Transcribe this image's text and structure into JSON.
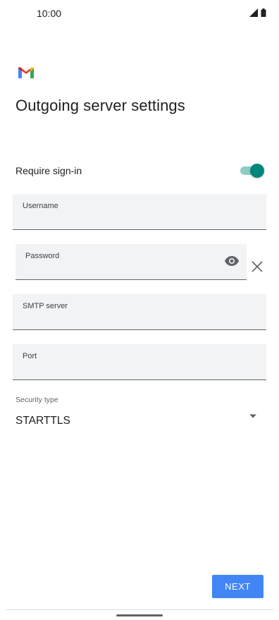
{
  "status_bar": {
    "time": "10:00",
    "icons": [
      "signal-icon",
      "battery-icon"
    ]
  },
  "app": {
    "logo_icon": "gmail-icon"
  },
  "page": {
    "title": "Outgoing server settings"
  },
  "require_sign_in": {
    "label": "Require sign-in",
    "enabled": true
  },
  "fields": {
    "username": {
      "label": "Username",
      "value": ""
    },
    "password": {
      "label": "Password",
      "value": "",
      "toggle_icon": "eye-icon",
      "clear_icon": "close-icon"
    },
    "smtp_server": {
      "label": "SMTP server",
      "value": ""
    },
    "port": {
      "label": "Port",
      "value": ""
    }
  },
  "security": {
    "label": "Security type",
    "value": "STARTTLS",
    "icon": "dropdown-arrow-icon"
  },
  "actions": {
    "next_label": "NEXT"
  },
  "colors": {
    "accent": "#00877a",
    "button": "#4285f4",
    "field_bg": "#f1f3f4"
  }
}
